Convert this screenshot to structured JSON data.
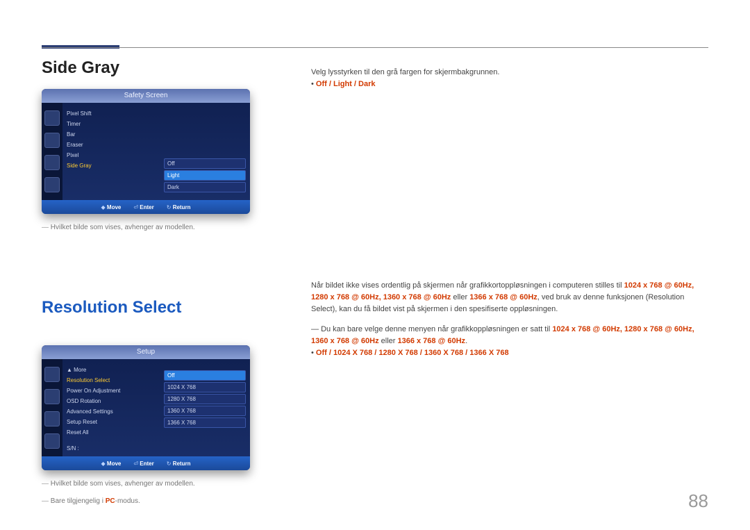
{
  "section1": {
    "heading": "Side Gray",
    "osd": {
      "title": "Safety Screen",
      "menu": [
        "Pixel Shift",
        "Timer",
        "Bar",
        "Eraser",
        "Pixel",
        "Side Gray"
      ],
      "selectedIndex": 5,
      "values": [
        "Off",
        "Light",
        "Dark"
      ],
      "valueSelected": 1,
      "footer": {
        "move": "Move",
        "enter": "Enter",
        "return": "Return"
      }
    },
    "note1": "Hvilket bilde som vises, avhenger av modellen.",
    "rtext": "Velg lysstyrken til den grå fargen for skjermbakgrunnen.",
    "options": "Off / Light / Dark"
  },
  "section2": {
    "heading": "Resolution Select",
    "osd": {
      "title": "Setup",
      "more": "▲ More",
      "menu": [
        "Resolution Select",
        "Power On Adjustment",
        "OSD Rotation",
        "Advanced Settings",
        "Setup Reset",
        "Reset All"
      ],
      "selectedIndex": 0,
      "sn": "S/N : ",
      "values": [
        "Off",
        "1024 X 768",
        "1280 X 768",
        "1360 X 768",
        "1366 X 768"
      ],
      "valueSelected": 0,
      "footer": {
        "move": "Move",
        "enter": "Enter",
        "return": "Return"
      }
    },
    "note1": "Hvilket bilde som vises, avhenger av modellen.",
    "note2_a": "Bare tilgjengelig i ",
    "note2_pc": "PC",
    "note2_b": "-modus.",
    "rtext1_a": "Når bildet ikke vises ordentlig på skjermen når grafikkortoppløsningen i computeren stilles til ",
    "rtext1_hl1": "1024 x 768 @ 60Hz",
    "rtext1_comma": ", ",
    "rtext1_hl2": "1280 x 768 @ 60Hz",
    "rtext1_comma2": ", ",
    "rtext1_hl3": "1360 x 768 @ 60Hz",
    "rtext1_eller": " eller ",
    "rtext1_hl4": "1366 x 768 @ 60Hz",
    "rtext1_b": ", ved bruk av denne funksjonen (Resolution Select), kan du få bildet vist på skjermen i den spesifiserte oppløsningen.",
    "rtext2_a": "Du kan bare velge denne menyen når grafikkoppløsningen er satt til ",
    "rtext2_hl1": "1024 x 768 @ 60Hz",
    "rtext2_c1": ", ",
    "rtext2_hl2": "1280 x 768 @ 60Hz",
    "rtext2_c2": ", ",
    "rtext2_hl3": "1360 x 768 @ 60Hz",
    "rtext2_eller": " eller ",
    "rtext2_hl4": "1366 x 768 @ 60Hz",
    "rtext2_b": ".",
    "options": "Off / 1024 X 768 / 1280 X 768 / 1360 X 768 / 1366 X 768"
  },
  "pageNumber": "88"
}
